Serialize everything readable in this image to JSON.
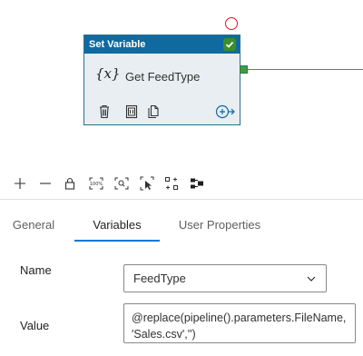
{
  "canvas": {
    "activity": {
      "type_label": "Set Variable",
      "name": "Get FeedType",
      "type_glyph": "{x}",
      "status": "succeeded",
      "actions": [
        {
          "icon": "delete-icon"
        },
        {
          "icon": "view-source-icon"
        },
        {
          "icon": "copy-icon"
        },
        {
          "icon": "add-output-icon"
        }
      ]
    },
    "breakpoint_icon": "breakpoint-circle-icon"
  },
  "toolbar": {
    "buttons": [
      {
        "icon": "zoom-in-icon"
      },
      {
        "icon": "zoom-out-icon"
      },
      {
        "icon": "lock-icon"
      },
      {
        "icon": "zoom-100-icon"
      },
      {
        "icon": "fit-to-window-icon"
      },
      {
        "icon": "select-icon"
      },
      {
        "icon": "auto-align-icon"
      },
      {
        "icon": "layout-icon"
      }
    ]
  },
  "tabs": [
    {
      "label": "General",
      "active": false
    },
    {
      "label": "Variables",
      "active": true
    },
    {
      "label": "User Properties",
      "active": false
    }
  ],
  "form": {
    "name_label": "Name",
    "name_value": "FeedType",
    "value_label": "Value",
    "value_text": "@replace(pipeline().parameters.FileName, 'Sales.csv','')"
  },
  "colors": {
    "header_blue": "#0f6aa0",
    "success_green": "#3a8f2a",
    "connector_green": "#3f9a4a",
    "breakpoint_red": "#e81123",
    "accent_blue": "#0078d4"
  }
}
